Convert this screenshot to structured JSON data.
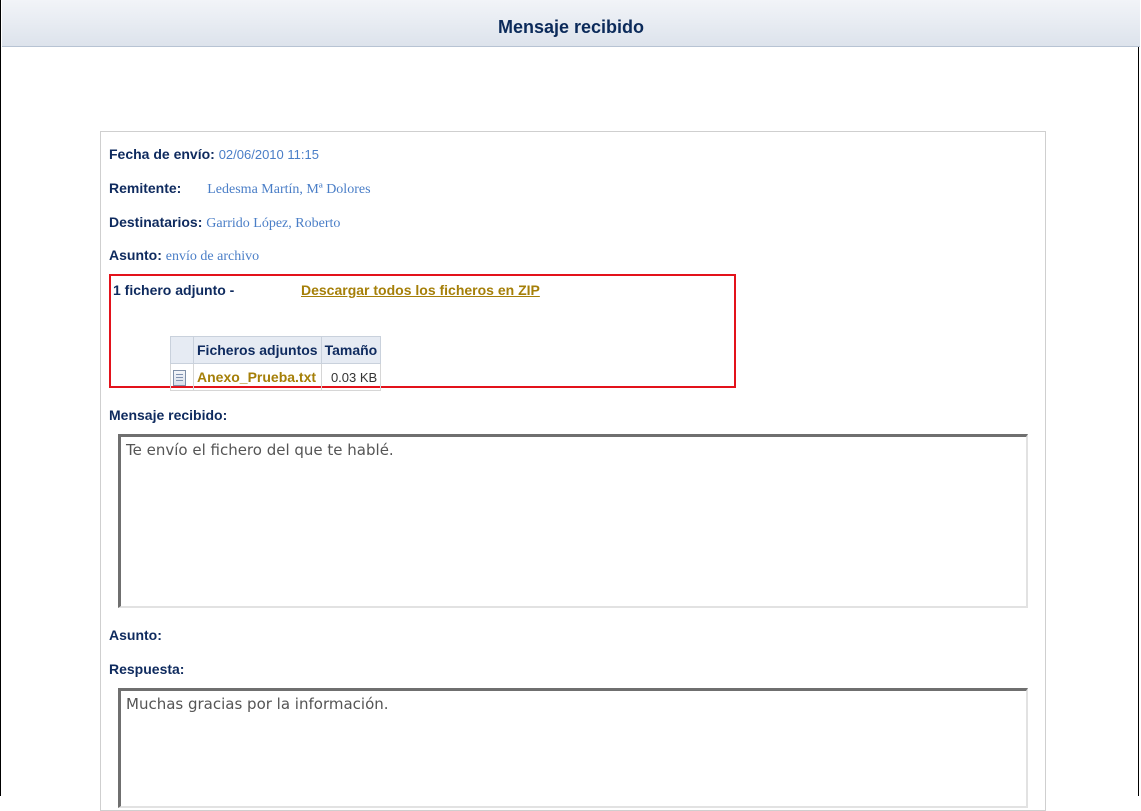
{
  "window": {
    "title": "Mensaje recibido"
  },
  "message": {
    "fecha_label": "Fecha de envío:",
    "fecha_value": "02/06/2010 11:15",
    "remitente_label": "Remitente:",
    "remitente_value": "Ledesma Martín, Mª Dolores",
    "destinatarios_label": "Destinatarios:",
    "destinatarios_value": "Garrido López, Roberto",
    "asunto_label": "Asunto:",
    "asunto_value": "envío de archivo"
  },
  "attachments": {
    "count_text": "1 fichero adjunto -",
    "zip_link": "Descargar todos los ficheros en ZIP",
    "columns": [
      "Ficheros adjuntos",
      "Tamaño"
    ],
    "files": [
      {
        "name": "Anexo_Prueba.txt",
        "size": "0.03 KB",
        "icon": "text-file-icon"
      }
    ]
  },
  "received": {
    "label": "Mensaje recibido:",
    "body": "Te envío el fichero del que te hablé."
  },
  "reply": {
    "asunto_label": "Asunto:",
    "respuesta_label": "Respuesta:",
    "body": "Muchas gracias por la información."
  },
  "colors": {
    "title": "#0b2a5a",
    "label": "#0e2a5e",
    "value": "#4a7ec7",
    "link": "#a57f08",
    "highlight": "#e3121b"
  }
}
